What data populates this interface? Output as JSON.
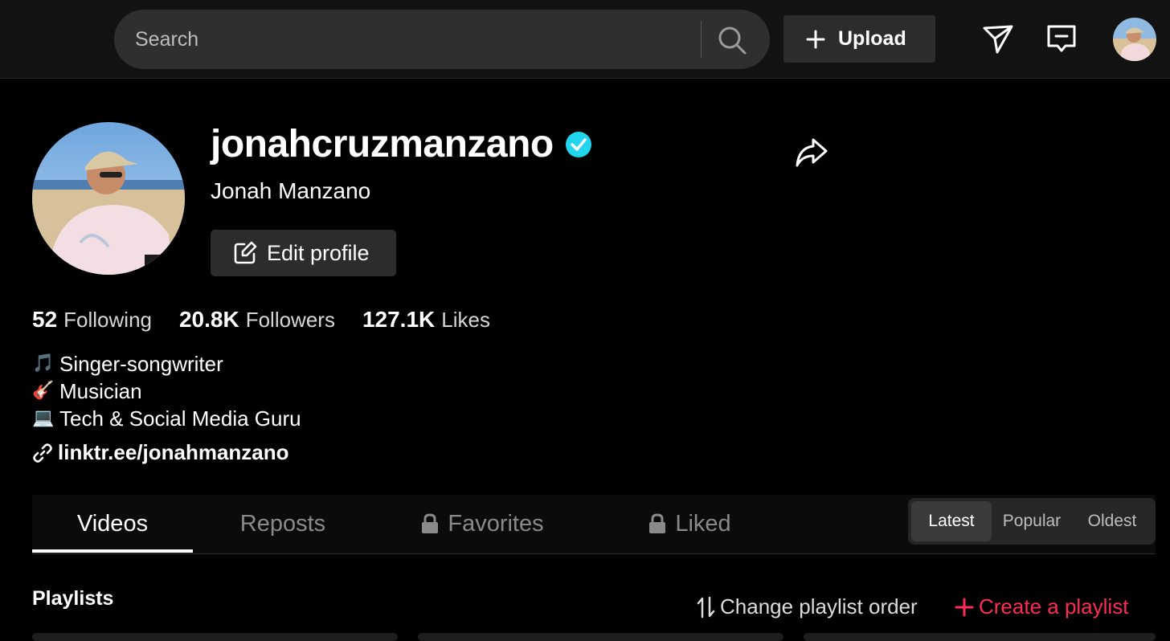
{
  "topbar": {
    "search_placeholder": "Search",
    "upload_label": "Upload"
  },
  "profile": {
    "username": "jonahcruzmanzano",
    "verified": true,
    "display_name": "Jonah Manzano",
    "edit_label": "Edit profile",
    "stats": [
      {
        "value": "52",
        "label": "Following"
      },
      {
        "value": "20.8K",
        "label": "Followers"
      },
      {
        "value": "127.1K",
        "label": "Likes"
      }
    ],
    "bio": [
      {
        "icon": "🎵",
        "text": "Singer-songwriter"
      },
      {
        "icon": "🎸",
        "text": "Musician"
      },
      {
        "icon": "💻",
        "text": "Tech & Social Media Guru"
      }
    ],
    "link": "linktr.ee/jonahmanzano"
  },
  "tabs": [
    {
      "label": "Videos",
      "locked": false,
      "active": true
    },
    {
      "label": "Reposts",
      "locked": false,
      "active": false
    },
    {
      "label": "Favorites",
      "locked": true,
      "active": false
    },
    {
      "label": "Liked",
      "locked": true,
      "active": false
    }
  ],
  "sort": {
    "options": [
      "Latest",
      "Popular",
      "Oldest"
    ],
    "selected": "Latest"
  },
  "playlists": {
    "title": "Playlists",
    "change_order_label": "Change playlist order",
    "create_label": "Create a playlist"
  },
  "colors": {
    "accent": "#fe2c55",
    "verified": "#20d5ec",
    "background": "#000000"
  }
}
